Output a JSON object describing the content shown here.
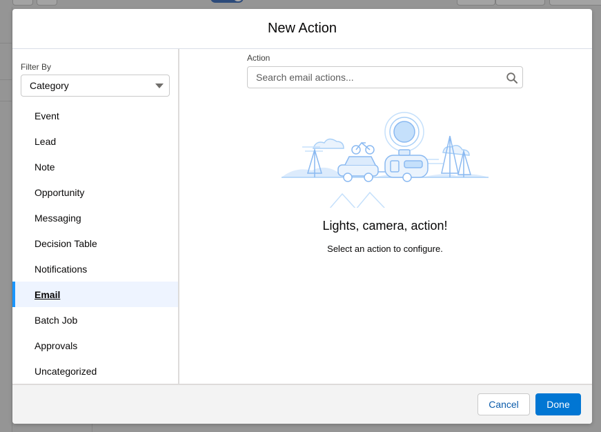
{
  "modal": {
    "title": "New Action"
  },
  "filter": {
    "label": "Filter By",
    "selected": "Category"
  },
  "categories": [
    {
      "label": "Event",
      "active": false
    },
    {
      "label": "Lead",
      "active": false
    },
    {
      "label": "Note",
      "active": false
    },
    {
      "label": "Opportunity",
      "active": false
    },
    {
      "label": "Messaging",
      "active": false
    },
    {
      "label": "Decision Table",
      "active": false
    },
    {
      "label": "Notifications",
      "active": false
    },
    {
      "label": "Email",
      "active": true
    },
    {
      "label": "Batch Job",
      "active": false
    },
    {
      "label": "Approvals",
      "active": false
    },
    {
      "label": "Uncategorized",
      "active": false
    }
  ],
  "action": {
    "label": "Action",
    "search_placeholder": "Search email actions..."
  },
  "empty_state": {
    "title": "Lights, camera, action!",
    "subtitle": "Select an action to configure.",
    "illustration_icon": "camper-trailer-illustration"
  },
  "footer": {
    "cancel_label": "Cancel",
    "done_label": "Done"
  },
  "colors": {
    "accent": "#0176d3",
    "active_bg": "#eef4ff",
    "active_bar": "#1b96ff",
    "illustration": "#8ab9f1"
  }
}
